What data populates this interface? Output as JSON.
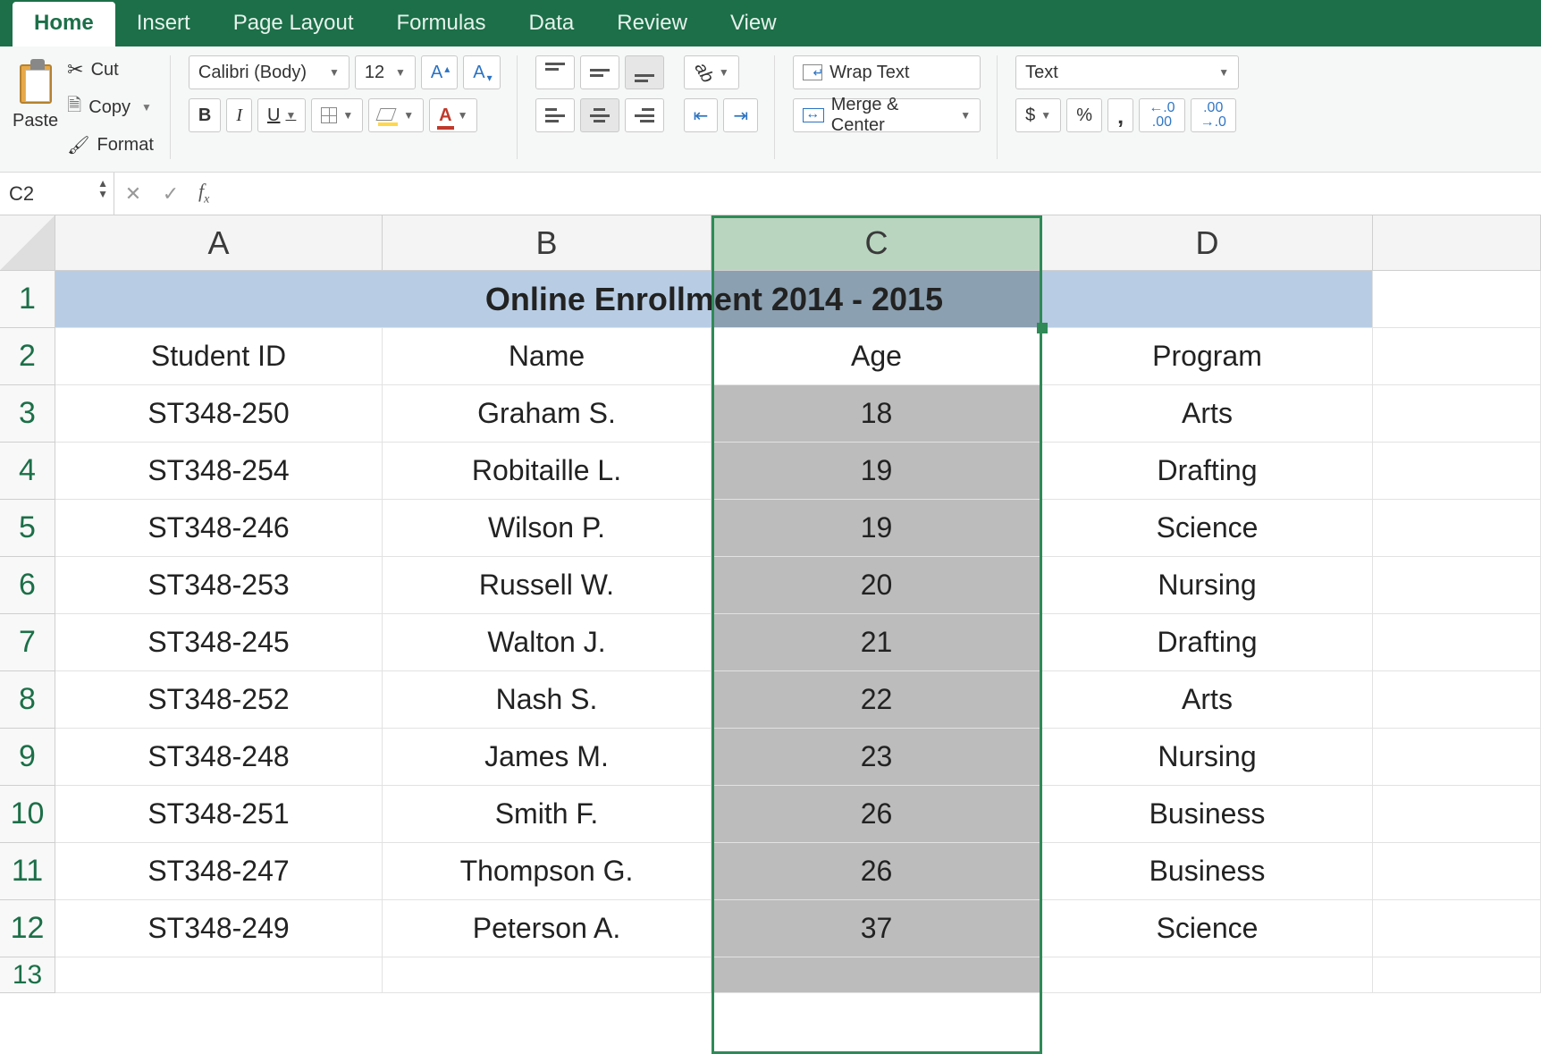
{
  "tabs": [
    "Home",
    "Insert",
    "Page Layout",
    "Formulas",
    "Data",
    "Review",
    "View"
  ],
  "active_tab": "Home",
  "clipboard": {
    "paste": "Paste",
    "cut": "Cut",
    "copy": "Copy",
    "format": "Format"
  },
  "font": {
    "name": "Calibri (Body)",
    "size": "12"
  },
  "alignment": {
    "wrap": "Wrap Text",
    "merge": "Merge & Center"
  },
  "number": {
    "format": "Text",
    "currency": "$",
    "percent": "%",
    "comma": "‚"
  },
  "namebox": "C2",
  "formula": "",
  "columns": [
    "A",
    "B",
    "C",
    "D",
    ""
  ],
  "selected_column_index": 2,
  "row_labels": [
    "1",
    "2",
    "3",
    "4",
    "5",
    "6",
    "7",
    "8",
    "9",
    "10",
    "11",
    "12",
    "13"
  ],
  "title": "Online Enrollment 2014 - 2015",
  "headers": {
    "a": "Student ID",
    "b": "Name",
    "c": "Age",
    "d": "Program"
  },
  "rows": [
    {
      "a": "ST348-250",
      "b": "Graham S.",
      "c": "18",
      "d": "Arts"
    },
    {
      "a": "ST348-254",
      "b": "Robitaille L.",
      "c": "19",
      "d": "Drafting"
    },
    {
      "a": "ST348-246",
      "b": "Wilson P.",
      "c": "19",
      "d": "Science"
    },
    {
      "a": "ST348-253",
      "b": "Russell W.",
      "c": "20",
      "d": "Nursing"
    },
    {
      "a": "ST348-245",
      "b": "Walton J.",
      "c": "21",
      "d": "Drafting"
    },
    {
      "a": "ST348-252",
      "b": "Nash S.",
      "c": "22",
      "d": "Arts"
    },
    {
      "a": "ST348-248",
      "b": "James M.",
      "c": "23",
      "d": "Nursing"
    },
    {
      "a": "ST348-251",
      "b": "Smith F.",
      "c": "26",
      "d": "Business"
    },
    {
      "a": "ST348-247",
      "b": "Thompson G.",
      "c": "26",
      "d": "Business"
    },
    {
      "a": "ST348-249",
      "b": "Peterson A.",
      "c": "37",
      "d": "Science"
    }
  ]
}
